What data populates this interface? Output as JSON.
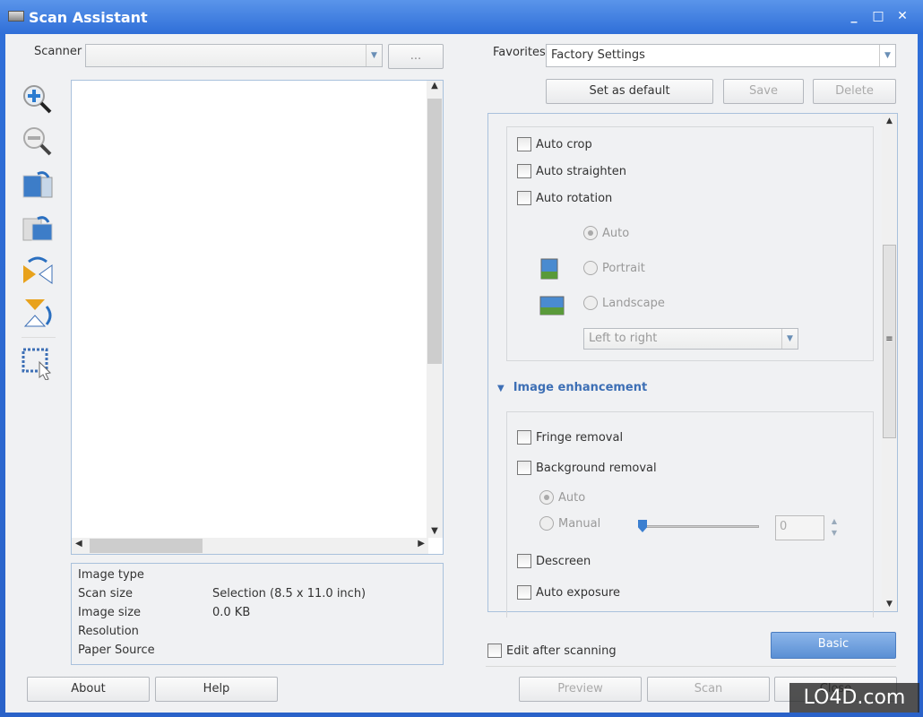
{
  "window": {
    "title": "Scan Assistant",
    "controls": [
      "minimize",
      "maximize",
      "close"
    ]
  },
  "scanner": {
    "label": "Scanner",
    "value": "",
    "browse_label": "..."
  },
  "toolbar": {
    "icons": [
      "zoom-in-icon",
      "zoom-out-icon",
      "fit-page-icon",
      "fit-width-icon",
      "flip-horizontal-icon",
      "flip-vertical-icon",
      "select-area-icon"
    ]
  },
  "info": {
    "rows": [
      {
        "label": "Image type",
        "value": ""
      },
      {
        "label": "Scan size",
        "value": "Selection (8.5 x 11.0 inch)"
      },
      {
        "label": "Image size",
        "value": "0.0 KB"
      },
      {
        "label": "Resolution",
        "value": ""
      },
      {
        "label": "Paper Source",
        "value": ""
      }
    ]
  },
  "favorites": {
    "label": "Favorites",
    "value": "Factory Settings",
    "set_default": "Set as default",
    "save": "Save",
    "delete": "Delete"
  },
  "settings": {
    "auto_crop": "Auto crop",
    "auto_straighten": "Auto straighten",
    "auto_rotation": "Auto rotation",
    "rotation_auto": "Auto",
    "rotation_portrait": "Portrait",
    "rotation_landscape": "Landscape",
    "direction": "Left to right",
    "image_enhancement": "Image enhancement",
    "fringe_removal": "Fringe removal",
    "background_removal": "Background removal",
    "bg_auto": "Auto",
    "bg_manual": "Manual",
    "bg_value": "0",
    "descreen": "Descreen",
    "auto_exposure": "Auto exposure"
  },
  "edit_after": "Edit after scanning",
  "buttons": {
    "basic": "Basic",
    "about": "About",
    "help": "Help",
    "preview": "Preview",
    "scan": "Scan",
    "close": "Close"
  },
  "watermark": "LO4D.com",
  "colors": {
    "titlebar": "#2f6fd8",
    "accent": "#3d6fb5",
    "basic_button": "#6b9bd8"
  }
}
